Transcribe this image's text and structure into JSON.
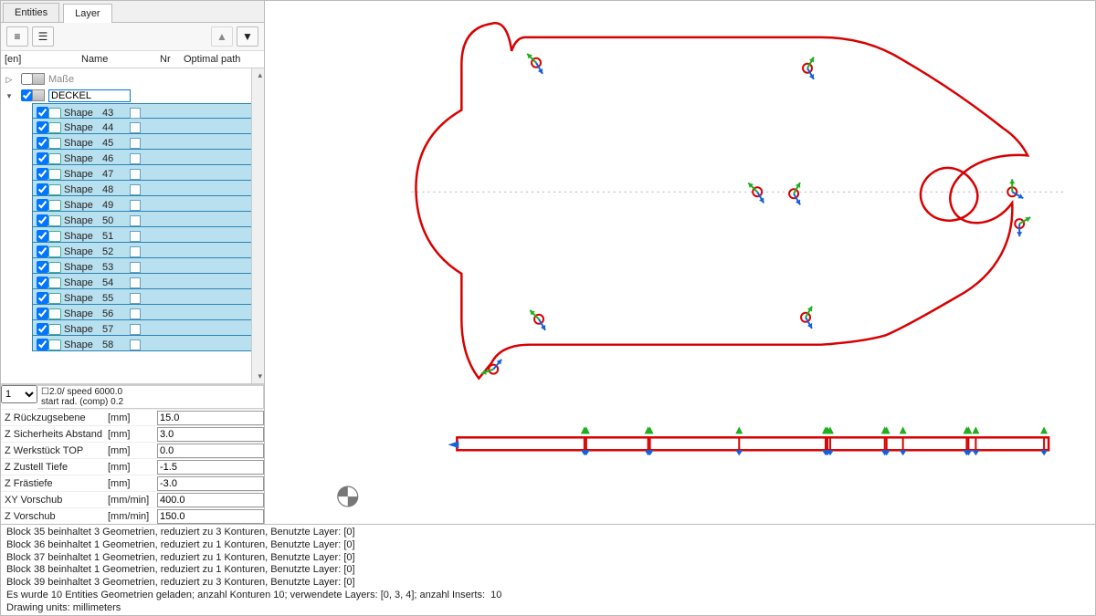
{
  "tabs": {
    "entities": "Entities",
    "layer": "Layer"
  },
  "tree": {
    "head": {
      "en": "[en]",
      "name": "Name",
      "nr": "Nr",
      "opt": "Optimal path"
    },
    "root_masse": "Maße",
    "root_deckel": "DECKEL",
    "shapes": [
      {
        "nr": "43"
      },
      {
        "nr": "44"
      },
      {
        "nr": "45"
      },
      {
        "nr": "46"
      },
      {
        "nr": "47"
      },
      {
        "nr": "48"
      },
      {
        "nr": "49"
      },
      {
        "nr": "50"
      },
      {
        "nr": "51"
      },
      {
        "nr": "52"
      },
      {
        "nr": "53"
      },
      {
        "nr": "54"
      },
      {
        "nr": "55"
      },
      {
        "nr": "56"
      },
      {
        "nr": "57"
      },
      {
        "nr": "58"
      }
    ],
    "shape_label": "Shape"
  },
  "tool": {
    "selected": "1",
    "summary_a": "☐2.0/ speed 6000.0",
    "summary_b": "start rad. (comp) 0.2"
  },
  "params": [
    {
      "label": "Z Rückzugsebene",
      "unit": "[mm]",
      "value": "15.0"
    },
    {
      "label": "Z Sicherheits Abstand",
      "unit": "[mm]",
      "value": "3.0"
    },
    {
      "label": "Z Werkstück TOP",
      "unit": "[mm]",
      "value": "0.0"
    },
    {
      "label": "Z Zustell Tiefe",
      "unit": "[mm]",
      "value": "-1.5"
    },
    {
      "label": "Z Frästiefe",
      "unit": "[mm]",
      "value": "-3.0"
    },
    {
      "label": "XY Vorschub",
      "unit": "[mm/min]",
      "value": "400.0"
    },
    {
      "label": "Z Vorschub",
      "unit": "[mm/min]",
      "value": "150.0"
    }
  ],
  "log": [
    "Block 35 beinhaltet 3 Geometrien, reduziert zu 3 Konturen, Benutzte Layer: [0]",
    "Block 36 beinhaltet 1 Geometrien, reduziert zu 1 Konturen, Benutzte Layer: [0]",
    "Block 37 beinhaltet 1 Geometrien, reduziert zu 1 Konturen, Benutzte Layer: [0]",
    "Block 38 beinhaltet 1 Geometrien, reduziert zu 1 Konturen, Benutzte Layer: [0]",
    "Block 39 beinhaltet 3 Geometrien, reduziert zu 3 Konturen, Benutzte Layer: [0]",
    "Es wurde 10 Entities Geometrien geladen; anzahl Konturen 10; verwendete Layers: [0, 3, 4]; anzahl Inserts:  10",
    "Drawing units: millimeters"
  ],
  "colors": {
    "outline": "#d80000",
    "marker_green": "#1fae1f",
    "marker_blue": "#1760d8"
  }
}
